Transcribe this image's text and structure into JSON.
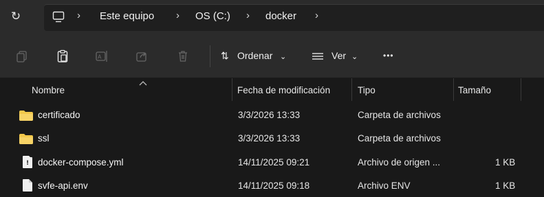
{
  "address_bar": {
    "breadcrumbs": [
      "Este equipo",
      "OS (C:)",
      "docker"
    ]
  },
  "toolbar": {
    "sort_label": "Ordenar",
    "view_label": "Ver",
    "more_label": "•••"
  },
  "columns": {
    "name": "Nombre",
    "modified": "Fecha de modificación",
    "type": "Tipo",
    "size": "Tamaño"
  },
  "files": [
    {
      "name": "certificado",
      "modified": "3/3/2026 13:33",
      "type": "Carpeta de archivos",
      "size": "",
      "icon": "folder-icon"
    },
    {
      "name": "ssl",
      "modified": "3/3/2026 13:33",
      "type": "Carpeta de archivos",
      "size": "",
      "icon": "folder-icon"
    },
    {
      "name": "docker-compose.yml",
      "modified": "14/11/2025 09:21",
      "type": "Archivo de origen ...",
      "size": "1 KB",
      "icon": "yml-file-icon"
    },
    {
      "name": "svfe-api.env",
      "modified": "14/11/2025 09:18",
      "type": "Archivo ENV",
      "size": "1 KB",
      "icon": "document-icon"
    }
  ],
  "colors": {
    "folder": "#f2c84b",
    "background": "#191919",
    "toolbar": "#2b2b2b"
  }
}
